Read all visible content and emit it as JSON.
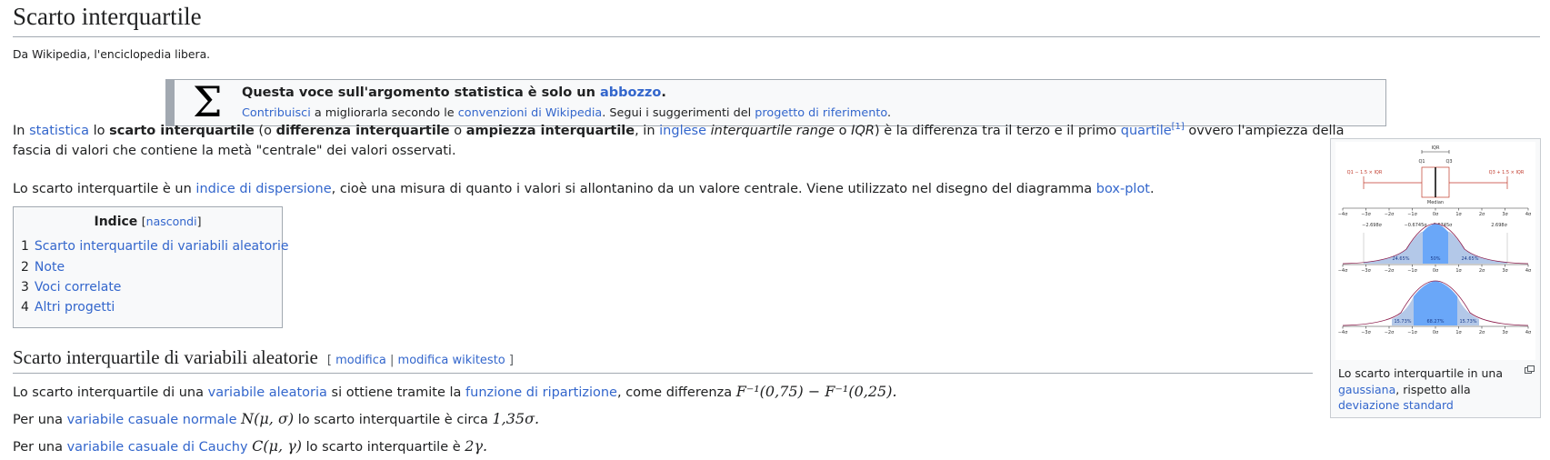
{
  "page": {
    "title": "Scarto interquartile",
    "tagline": "Da Wikipedia, l'enciclopedia libera."
  },
  "ambox": {
    "sigma": "Σ",
    "line1_pre": "Questa voce sull'argomento statistica è solo un ",
    "line1_link": "abbozzo",
    "line1_post": ".",
    "line2_link1": "Contribuisci",
    "line2_mid": " a migliorarla secondo le ",
    "line2_link2": "convenzioni di Wikipedia",
    "line2_mid2": ". Segui i suggerimenti del ",
    "line2_link3": "progetto di riferimento",
    "line2_post": "."
  },
  "intro": {
    "p1a": "In ",
    "p1_link_statistica": "statistica",
    "p1b": " lo ",
    "p1_bold1": "scarto interquartile",
    "p1c": " (o ",
    "p1_bold2": "differenza interquartile",
    "p1d": " o ",
    "p1_bold3": "ampiezza interquartile",
    "p1e": ", in ",
    "p1_link_inglese": "inglese",
    "p1f": " ",
    "p1_italic1": "interquartile range",
    "p1g": " o ",
    "p1_italic2": "IQR",
    "p1h": ") è la differenza tra il terzo e il primo ",
    "p1_link_quartile": "quartile",
    "p1_ref": "[1]",
    "p1i": " ovvero l'ampiezza della",
    "p1_line2": "fascia di valori che contiene la metà \"centrale\" dei valori osservati.",
    "p2a": "Lo scarto interquartile è un ",
    "p2_link1": "indice di dispersione",
    "p2b": ", cioè una misura di quanto i valori si allontanino da un valore centrale. Viene utilizzato nel disegno del diagramma ",
    "p2_link2": "box-plot",
    "p2c": "."
  },
  "toc": {
    "title": "Indice",
    "toggle_open": "[",
    "toggle_label": "nascondi",
    "toggle_close": "]",
    "items": [
      {
        "num": "1",
        "label": "Scarto interquartile di variabili aleatorie"
      },
      {
        "num": "2",
        "label": "Note"
      },
      {
        "num": "3",
        "label": "Voci correlate"
      },
      {
        "num": "4",
        "label": "Altri progetti"
      }
    ]
  },
  "section": {
    "heading": "Scarto interquartile di variabili aleatorie",
    "edit_open": "[ ",
    "edit1": "modifica",
    "edit_sep": " | ",
    "edit2": "modifica wikitesto",
    "edit_close": " ]",
    "s1a": "Lo scarto interquartile di una ",
    "s1_link1": "variabile aleatoria",
    "s1b": " si ottiene tramite la ",
    "s1_link2": "funzione di ripartizione",
    "s1c": ", come differenza ",
    "s1_math": "F⁻¹(0,75) − F⁻¹(0,25).",
    "s2a": "Per una ",
    "s2_link": "variabile casuale normale",
    "s2_math1": "N(μ, σ)",
    "s2b": " lo scarto interquartile è circa ",
    "s2_math2": "1,35σ.",
    "s3a": "Per una ",
    "s3_link": "variabile casuale di Cauchy",
    "s3_math1": "C(μ, γ)",
    "s3b": " lo scarto interquartile è ",
    "s3_math2": "2γ."
  },
  "figure": {
    "caption_a": "Lo scarto interquartile in una ",
    "caption_link1": "gaussiana",
    "caption_b": ", rispetto alla ",
    "caption_link2": "deviazione standard",
    "labels": {
      "iqr": "IQR",
      "q1": "Q1",
      "q3": "Q3",
      "q1_whisker": "Q1 − 1.5 × IQR",
      "q3_whisker": "Q3 + 1.5 × IQR",
      "median": "Median",
      "v_neg2698": "−2.698σ",
      "v_neg06745": "−0.6745σ",
      "v_pos06745": "0.6745σ",
      "v_pos2698": "2.698σ",
      "pct_24": "24.65%",
      "pct_50": "50%",
      "pct_24b": "24.65%",
      "pct_15": "15.73%",
      "pct_68": "68.27%",
      "pct_15b": "15.73%"
    },
    "axis_ticks": [
      "−4σ",
      "−3σ",
      "−2σ",
      "−1σ",
      "0σ",
      "1σ",
      "2σ",
      "3σ",
      "4σ"
    ],
    "colors": {
      "box": "#c0392b",
      "fill_dark": "#6aa7f8",
      "fill_light": "#b3c8e8",
      "curve": "#8b1a4a"
    }
  }
}
